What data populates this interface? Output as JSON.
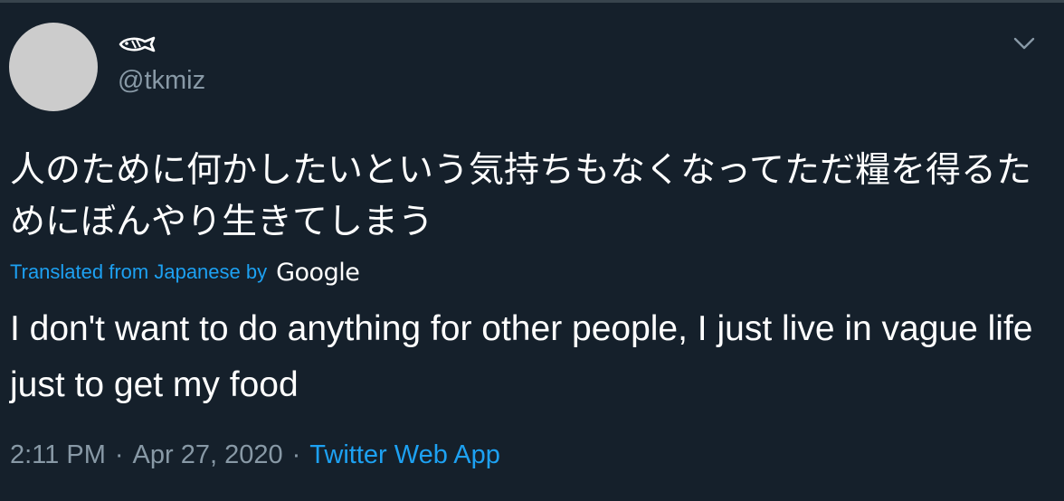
{
  "tweet": {
    "display_name_icon": "fish-icon",
    "handle": "@tkmiz",
    "original_text": "人のために何かしたいという気持ちもなくなってただ糧を得るためにぼんやり生きてしまう",
    "translated_label": "Translated from Japanese by",
    "translator_brand": "Google",
    "translation": "I don't want to do anything for other people, I just live in vague life just to get my food",
    "time": "2:11 PM",
    "separator1": "·",
    "date": "Apr 27, 2020",
    "separator2": "·",
    "source": "Twitter Web App",
    "more_icon": "chevron-down-icon"
  },
  "colors": {
    "background": "#15202b",
    "text": "#ffffff",
    "secondary": "#8899a6",
    "accent": "#1da1f2",
    "avatar_placeholder": "#cccccc"
  }
}
